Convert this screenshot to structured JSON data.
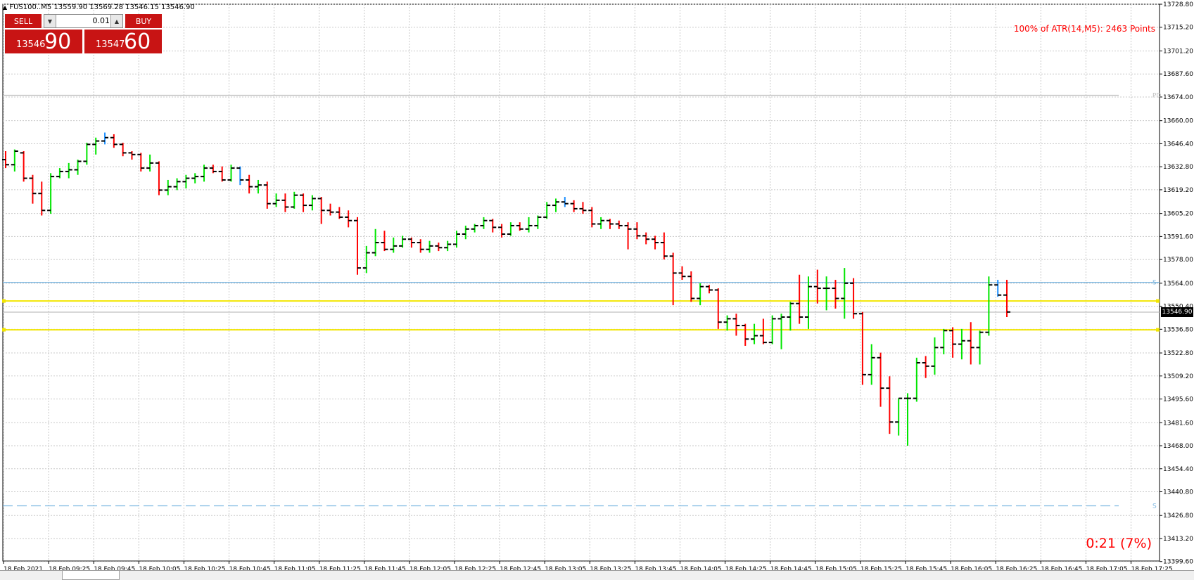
{
  "window": {
    "header": "FUS100..M5  13559.90 13569.28 13546.15 13546.90"
  },
  "trade_panel": {
    "sell_label": "SELL",
    "buy_label": "BUY",
    "lot_value": "0.01",
    "sell_price_small": "13546",
    "sell_price_big": "90",
    "buy_price_small": "13547",
    "buy_price_big": "60",
    "down_icon": "triangle-down-icon",
    "up_icon": "triangle-up-icon"
  },
  "indicators": {
    "atr_text": "100% of ATR(14,M5): 2463  Points",
    "timer_text": "0:21 (7%)",
    "current_price_tag": "13546.90"
  },
  "colors": {
    "bull": "#00e600",
    "bear": "#ff0000",
    "accent_bar": "#1e90ff",
    "grid": "#c8c8c8",
    "level_yellow": "#f2e600",
    "level_blue": "#7ab6e0",
    "level_gray": "#c0c0c0",
    "panel_red": "#c81414"
  },
  "chart_data": {
    "type": "ohlc",
    "symbol": "FUS100.",
    "timeframe": "M5",
    "grid": true,
    "ylim": [
      13399.9,
      13728.8
    ],
    "y_ticks": [
      "13728.80",
      "13715.20",
      "13701.20",
      "13687.60",
      "13674.00",
      "13660.00",
      "13646.40",
      "13632.80",
      "13619.20",
      "13605.20",
      "13591.60",
      "13578.00",
      "13564.00",
      "13550.40",
      "13536.80",
      "13522.80",
      "13509.20",
      "13495.60",
      "13481.60",
      "13468.00",
      "13454.40",
      "13440.80",
      "13426.80",
      "13413.20",
      "13399.60"
    ],
    "x_ticks": [
      "18 Feb 2021",
      "18 Feb 09:25",
      "18 Feb 09:45",
      "18 Feb 10:05",
      "18 Feb 10:25",
      "18 Feb 10:45",
      "18 Feb 11:05",
      "18 Feb 11:25",
      "18 Feb 11:45",
      "18 Feb 12:05",
      "18 Feb 12:25",
      "18 Feb 12:45",
      "18 Feb 13:05",
      "18 Feb 13:25",
      "18 Feb 13:45",
      "18 Feb 14:05",
      "18 Feb 14:25",
      "18 Feb 14:45",
      "18 Feb 15:05",
      "18 Feb 15:25",
      "18 Feb 15:45",
      "18 Feb 16:05",
      "18 Feb 16:25",
      "18 Feb 16:45",
      "18 Feb 17:05",
      "18 Feb 17:25"
    ],
    "levels": [
      {
        "price": 13675.0,
        "style": "solid",
        "color": "#c0c0c0",
        "tag": "PD"
      },
      {
        "price": 13564.5,
        "style": "solid",
        "color": "#7ab6e0",
        "tag": "S"
      },
      {
        "price": 13553.5,
        "style": "solid",
        "color": "#f2e600",
        "tag": ""
      },
      {
        "price": 13546.9,
        "style": "solid",
        "color": "#c0c0c0",
        "tag": ""
      },
      {
        "price": 13536.5,
        "style": "solid",
        "color": "#f2e600",
        "tag": ""
      },
      {
        "price": 13432.5,
        "style": "dashed",
        "color": "#7ab6e0",
        "tag": "S"
      }
    ],
    "bars": [
      {
        "o": 13637,
        "h": 13642,
        "l": 13632,
        "c": 13634
      },
      {
        "o": 13634,
        "h": 13643,
        "l": 13630,
        "c": 13642
      },
      {
        "o": 13641,
        "h": 13642,
        "l": 13624,
        "c": 13626
      },
      {
        "o": 13626,
        "h": 13628,
        "l": 13611,
        "c": 13617
      },
      {
        "o": 13617,
        "h": 13624,
        "l": 13604,
        "c": 13607
      },
      {
        "o": 13607,
        "h": 13629,
        "l": 13605,
        "c": 13627
      },
      {
        "o": 13627,
        "h": 13632,
        "l": 13626,
        "c": 13630
      },
      {
        "o": 13630,
        "h": 13635,
        "l": 13626,
        "c": 13631
      },
      {
        "o": 13631,
        "h": 13637,
        "l": 13628,
        "c": 13636
      },
      {
        "o": 13636,
        "h": 13647,
        "l": 13634,
        "c": 13646
      },
      {
        "o": 13646,
        "h": 13650,
        "l": 13640,
        "c": 13648
      },
      {
        "o": 13648,
        "h": 13653,
        "l": 13646,
        "c": 13650
      },
      {
        "o": 13650,
        "h": 13652,
        "l": 13644,
        "c": 13646
      },
      {
        "o": 13646,
        "h": 13647,
        "l": 13639,
        "c": 13641
      },
      {
        "o": 13641,
        "h": 13642,
        "l": 13637,
        "c": 13640
      },
      {
        "o": 13640,
        "h": 13641,
        "l": 13630,
        "c": 13632
      },
      {
        "o": 13632,
        "h": 13640,
        "l": 13630,
        "c": 13635
      },
      {
        "o": 13635,
        "h": 13636,
        "l": 13616,
        "c": 13619
      },
      {
        "o": 13619,
        "h": 13625,
        "l": 13616,
        "c": 13621
      },
      {
        "o": 13621,
        "h": 13626,
        "l": 13619,
        "c": 13624
      },
      {
        "o": 13624,
        "h": 13628,
        "l": 13620,
        "c": 13626
      },
      {
        "o": 13626,
        "h": 13629,
        "l": 13623,
        "c": 13627
      },
      {
        "o": 13627,
        "h": 13634,
        "l": 13624,
        "c": 13632
      },
      {
        "o": 13632,
        "h": 13634,
        "l": 13629,
        "c": 13630
      },
      {
        "o": 13630,
        "h": 13633,
        "l": 13624,
        "c": 13625
      },
      {
        "o": 13625,
        "h": 13634,
        "l": 13624,
        "c": 13632
      },
      {
        "o": 13632,
        "h": 13633,
        "l": 13622,
        "c": 13625
      },
      {
        "o": 13625,
        "h": 13628,
        "l": 13617,
        "c": 13621
      },
      {
        "o": 13621,
        "h": 13625,
        "l": 13617,
        "c": 13622
      },
      {
        "o": 13622,
        "h": 13624,
        "l": 13608,
        "c": 13611
      },
      {
        "o": 13611,
        "h": 13617,
        "l": 13609,
        "c": 13613
      },
      {
        "o": 13613,
        "h": 13617,
        "l": 13606,
        "c": 13609
      },
      {
        "o": 13609,
        "h": 13618,
        "l": 13608,
        "c": 13616
      },
      {
        "o": 13616,
        "h": 13617,
        "l": 13606,
        "c": 13610
      },
      {
        "o": 13610,
        "h": 13616,
        "l": 13607,
        "c": 13614
      },
      {
        "o": 13614,
        "h": 13615,
        "l": 13599,
        "c": 13607
      },
      {
        "o": 13607,
        "h": 13611,
        "l": 13604,
        "c": 13606
      },
      {
        "o": 13606,
        "h": 13609,
        "l": 13602,
        "c": 13603
      },
      {
        "o": 13603,
        "h": 13607,
        "l": 13597,
        "c": 13601
      },
      {
        "o": 13601,
        "h": 13603,
        "l": 13569,
        "c": 13573
      },
      {
        "o": 13573,
        "h": 13586,
        "l": 13570,
        "c": 13582
      },
      {
        "o": 13582,
        "h": 13596,
        "l": 13580,
        "c": 13588
      },
      {
        "o": 13588,
        "h": 13595,
        "l": 13583,
        "c": 13584
      },
      {
        "o": 13584,
        "h": 13591,
        "l": 13582,
        "c": 13586
      },
      {
        "o": 13586,
        "h": 13592,
        "l": 13585,
        "c": 13590
      },
      {
        "o": 13590,
        "h": 13591,
        "l": 13585,
        "c": 13588
      },
      {
        "o": 13588,
        "h": 13590,
        "l": 13582,
        "c": 13584
      },
      {
        "o": 13584,
        "h": 13589,
        "l": 13582,
        "c": 13586
      },
      {
        "o": 13586,
        "h": 13588,
        "l": 13583,
        "c": 13585
      },
      {
        "o": 13585,
        "h": 13589,
        "l": 13583,
        "c": 13587
      },
      {
        "o": 13587,
        "h": 13595,
        "l": 13585,
        "c": 13593
      },
      {
        "o": 13593,
        "h": 13598,
        "l": 13590,
        "c": 13596
      },
      {
        "o": 13596,
        "h": 13599,
        "l": 13594,
        "c": 13598
      },
      {
        "o": 13598,
        "h": 13603,
        "l": 13596,
        "c": 13601
      },
      {
        "o": 13601,
        "h": 13602,
        "l": 13594,
        "c": 13597
      },
      {
        "o": 13597,
        "h": 13599,
        "l": 13591,
        "c": 13593
      },
      {
        "o": 13593,
        "h": 13600,
        "l": 13592,
        "c": 13598
      },
      {
        "o": 13598,
        "h": 13600,
        "l": 13595,
        "c": 13596
      },
      {
        "o": 13596,
        "h": 13603,
        "l": 13594,
        "c": 13598
      },
      {
        "o": 13598,
        "h": 13604,
        "l": 13596,
        "c": 13603
      },
      {
        "o": 13603,
        "h": 13612,
        "l": 13602,
        "c": 13610
      },
      {
        "o": 13610,
        "h": 13614,
        "l": 13606,
        "c": 13612
      },
      {
        "o": 13612,
        "h": 13615,
        "l": 13609,
        "c": 13611
      },
      {
        "o": 13611,
        "h": 13613,
        "l": 13606,
        "c": 13608
      },
      {
        "o": 13608,
        "h": 13612,
        "l": 13605,
        "c": 13607
      },
      {
        "o": 13607,
        "h": 13609,
        "l": 13597,
        "c": 13599
      },
      {
        "o": 13599,
        "h": 13603,
        "l": 13596,
        "c": 13601
      },
      {
        "o": 13601,
        "h": 13602,
        "l": 13596,
        "c": 13599
      },
      {
        "o": 13599,
        "h": 13601,
        "l": 13596,
        "c": 13598
      },
      {
        "o": 13598,
        "h": 13600,
        "l": 13584,
        "c": 13596
      },
      {
        "o": 13596,
        "h": 13600,
        "l": 13590,
        "c": 13592
      },
      {
        "o": 13592,
        "h": 13594,
        "l": 13587,
        "c": 13590
      },
      {
        "o": 13590,
        "h": 13592,
        "l": 13584,
        "c": 13588
      },
      {
        "o": 13588,
        "h": 13594,
        "l": 13578,
        "c": 13580
      },
      {
        "o": 13580,
        "h": 13582,
        "l": 13551,
        "c": 13570
      },
      {
        "o": 13570,
        "h": 13574,
        "l": 13566,
        "c": 13568
      },
      {
        "o": 13568,
        "h": 13571,
        "l": 13553,
        "c": 13555
      },
      {
        "o": 13555,
        "h": 13564,
        "l": 13551,
        "c": 13562
      },
      {
        "o": 13562,
        "h": 13563,
        "l": 13558,
        "c": 13560
      },
      {
        "o": 13560,
        "h": 13561,
        "l": 13537,
        "c": 13541
      },
      {
        "o": 13541,
        "h": 13545,
        "l": 13536,
        "c": 13543
      },
      {
        "o": 13543,
        "h": 13546,
        "l": 13533,
        "c": 13539
      },
      {
        "o": 13539,
        "h": 13540,
        "l": 13527,
        "c": 13531
      },
      {
        "o": 13531,
        "h": 13540,
        "l": 13528,
        "c": 13533
      },
      {
        "o": 13533,
        "h": 13543,
        "l": 13528,
        "c": 13529
      },
      {
        "o": 13529,
        "h": 13545,
        "l": 13528,
        "c": 13543
      },
      {
        "o": 13543,
        "h": 13546,
        "l": 13525,
        "c": 13544
      },
      {
        "o": 13544,
        "h": 13553,
        "l": 13536,
        "c": 13552
      },
      {
        "o": 13552,
        "h": 13569,
        "l": 13540,
        "c": 13544
      },
      {
        "o": 13544,
        "h": 13568,
        "l": 13537,
        "c": 13562
      },
      {
        "o": 13562,
        "h": 13572,
        "l": 13552,
        "c": 13561
      },
      {
        "o": 13561,
        "h": 13568,
        "l": 13548,
        "c": 13561
      },
      {
        "o": 13561,
        "h": 13566,
        "l": 13549,
        "c": 13555
      },
      {
        "o": 13555,
        "h": 13573,
        "l": 13543,
        "c": 13564
      },
      {
        "o": 13564,
        "h": 13567,
        "l": 13543,
        "c": 13546
      },
      {
        "o": 13546,
        "h": 13547,
        "l": 13504,
        "c": 13510
      },
      {
        "o": 13510,
        "h": 13528,
        "l": 13504,
        "c": 13520
      },
      {
        "o": 13520,
        "h": 13523,
        "l": 13491,
        "c": 13502
      },
      {
        "o": 13502,
        "h": 13509,
        "l": 13475,
        "c": 13482
      },
      {
        "o": 13482,
        "h": 13496,
        "l": 13474,
        "c": 13496
      },
      {
        "o": 13496,
        "h": 13499,
        "l": 13468,
        "c": 13496
      },
      {
        "o": 13496,
        "h": 13520,
        "l": 13494,
        "c": 13517
      },
      {
        "o": 13517,
        "h": 13521,
        "l": 13508,
        "c": 13515
      },
      {
        "o": 13515,
        "h": 13532,
        "l": 13510,
        "c": 13526
      },
      {
        "o": 13526,
        "h": 13537,
        "l": 13522,
        "c": 13536
      },
      {
        "o": 13536,
        "h": 13538,
        "l": 13520,
        "c": 13528
      },
      {
        "o": 13528,
        "h": 13537,
        "l": 13519,
        "c": 13530
      },
      {
        "o": 13530,
        "h": 13541,
        "l": 13516,
        "c": 13526
      },
      {
        "o": 13526,
        "h": 13536,
        "l": 13516,
        "c": 13535
      },
      {
        "o": 13535,
        "h": 13568,
        "l": 13533,
        "c": 13563
      },
      {
        "o": 13563,
        "h": 13566,
        "l": 13556,
        "c": 13557
      },
      {
        "o": 13557,
        "h": 13566,
        "l": 13544,
        "c": 13547
      }
    ]
  }
}
